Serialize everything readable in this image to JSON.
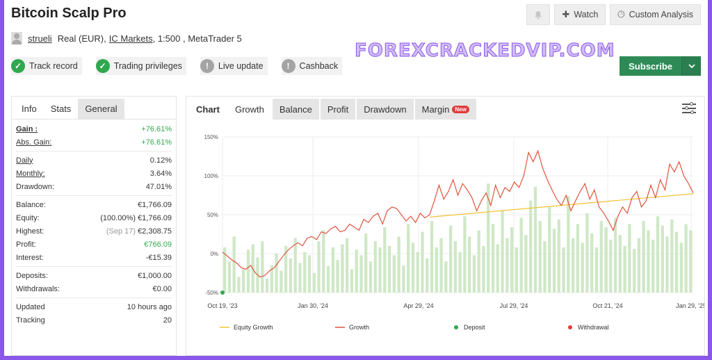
{
  "header": {
    "title": "Bitcoin Scalp Pro",
    "owner": "strueli",
    "account_type": "Real (EUR),",
    "broker": "IC Markets",
    "details": ", 1:500 , MetaTrader 5",
    "watch_label": "Watch",
    "custom_analysis_label": "Custom Analysis",
    "subscribe_label": "Subscribe"
  },
  "watermark": "FOREXCRACKEDVIP.COM",
  "badges": [
    {
      "label": "Track record",
      "status": "ok",
      "icon": "check-icon"
    },
    {
      "label": "Trading privileges",
      "status": "ok",
      "icon": "check-icon"
    },
    {
      "label": "Live update",
      "status": "warn",
      "icon": "exclamation-icon"
    },
    {
      "label": "Cashback",
      "status": "warn",
      "icon": "exclamation-icon"
    }
  ],
  "stats_tabs": [
    "Info",
    "Stats",
    "General"
  ],
  "stats": {
    "gain_label": "Gain :",
    "gain_value": "+76.61%",
    "abs_gain_label": "Abs. Gain:",
    "abs_gain_value": "+76.61%",
    "daily_label": "Daily",
    "daily_value": "0.12%",
    "monthly_label": "Monthly:",
    "monthly_value": "3.64%",
    "drawdown_label": "Drawdown:",
    "drawdown_value": "47.01%",
    "balance_label": "Balance:",
    "balance_value": "€1,766.09",
    "equity_label": "Equity:",
    "equity_pct": "(100.00%)",
    "equity_value": "€1,766.09",
    "highest_label": "Highest:",
    "highest_date": "(Sep 17)",
    "highest_value": "€2,308.75",
    "profit_label": "Profit:",
    "profit_value": "€766.09",
    "interest_label": "Interest:",
    "interest_value": "-€15.39",
    "deposits_label": "Deposits:",
    "deposits_value": "€1,000.00",
    "withdrawals_label": "Withdrawals:",
    "withdrawals_value": "€0.00",
    "updated_label": "Updated",
    "updated_value": "10 hours ago",
    "tracking_label": "Tracking",
    "tracking_value": "20"
  },
  "chart_tabs": [
    "Chart",
    "Growth",
    "Balance",
    "Profit",
    "Drawdown",
    "Margin"
  ],
  "new_badge": "New",
  "colors": {
    "growth": "#e0533d",
    "equity_growth": "#f2c231",
    "deposit": "#2fa84f",
    "withdrawal": "#e23b3b",
    "bars": "#cfe8c7",
    "subscribe": "#2e8b57"
  },
  "chart_data": {
    "type": "line",
    "ylim": [
      -50,
      150
    ],
    "yticks": [
      "150%",
      "100%",
      "50%",
      "0%",
      "-50%"
    ],
    "xticks": [
      "Oct 19, '23",
      "Jan 30, '24",
      "Apr 29, '24",
      "Jul 29, '24",
      "Oct 21, '24",
      "Jan 29, '25"
    ],
    "grid": true,
    "legend_position": "bottom",
    "series": [
      {
        "name": "Equity Growth",
        "type": "line",
        "x": [
          0,
          0.44,
          1.0
        ],
        "values": [
          null,
          47,
          77
        ]
      },
      {
        "name": "Growth",
        "type": "line",
        "x": [
          0,
          0.01,
          0.02,
          0.03,
          0.04,
          0.05,
          0.06,
          0.07,
          0.08,
          0.09,
          0.1,
          0.11,
          0.12,
          0.13,
          0.14,
          0.15,
          0.16,
          0.17,
          0.18,
          0.19,
          0.2,
          0.21,
          0.22,
          0.23,
          0.24,
          0.25,
          0.26,
          0.27,
          0.28,
          0.29,
          0.3,
          0.31,
          0.32,
          0.33,
          0.34,
          0.35,
          0.36,
          0.37,
          0.38,
          0.39,
          0.4,
          0.41,
          0.42,
          0.43,
          0.44,
          0.45,
          0.46,
          0.47,
          0.48,
          0.49,
          0.5,
          0.51,
          0.52,
          0.53,
          0.54,
          0.55,
          0.56,
          0.57,
          0.58,
          0.59,
          0.6,
          0.61,
          0.62,
          0.63,
          0.64,
          0.65,
          0.66,
          0.67,
          0.68,
          0.69,
          0.7,
          0.71,
          0.72,
          0.73,
          0.74,
          0.75,
          0.76,
          0.77,
          0.78,
          0.79,
          0.8,
          0.81,
          0.82,
          0.83,
          0.84,
          0.85,
          0.86,
          0.87,
          0.88,
          0.89,
          0.9,
          0.91,
          0.92,
          0.93,
          0.94,
          0.95,
          0.96,
          0.97,
          0.98,
          0.99,
          1.0
        ],
        "values": [
          2,
          -3,
          -8,
          -12,
          -18,
          -20,
          -15,
          -25,
          -30,
          -28,
          -22,
          -18,
          -10,
          -2,
          5,
          10,
          14,
          10,
          20,
          22,
          18,
          28,
          26,
          32,
          35,
          28,
          30,
          38,
          34,
          30,
          44,
          40,
          48,
          52,
          38,
          55,
          60,
          58,
          50,
          42,
          48,
          40,
          52,
          46,
          50,
          68,
          88,
          70,
          80,
          95,
          75,
          90,
          82,
          72,
          55,
          68,
          78,
          62,
          88,
          72,
          85,
          80,
          92,
          85,
          100,
          130,
          118,
          132,
          110,
          95,
          82,
          70,
          62,
          75,
          55,
          68,
          80,
          90,
          70,
          82,
          60,
          52,
          42,
          30,
          48,
          60,
          52,
          72,
          80,
          60,
          68,
          88,
          72,
          95,
          82,
          115,
          105,
          118,
          100,
          90,
          78
        ]
      },
      {
        "name": "Deposit",
        "type": "scatter",
        "x": [
          0
        ],
        "values": [
          -50
        ],
        "amount": "€1,000.00"
      },
      {
        "name": "Withdrawal",
        "type": "scatter",
        "x": [],
        "values": []
      }
    ],
    "bars": [
      58,
      40,
      72,
      20,
      30,
      55,
      62,
      45,
      66,
      18,
      35,
      50,
      28,
      60,
      44,
      70,
      38,
      52,
      48,
      25,
      66,
      80,
      34,
      58,
      42,
      62,
      70,
      30,
      55,
      48,
      76,
      40,
      66,
      58,
      84,
      60,
      48,
      72,
      35,
      88,
      64,
      52,
      78,
      44,
      92,
      58,
      70,
      40,
      86,
      66,
      52,
      98,
      72,
      48,
      80,
      60,
      140,
      88,
      62,
      106,
      70,
      84,
      58,
      96,
      74,
      118,
      136,
      92,
      66,
      110,
      82,
      94,
      58,
      124,
      70,
      88,
      64,
      102,
      76,
      58,
      92,
      84,
      68,
      96,
      74,
      60,
      88,
      56,
      70,
      92,
      80,
      68,
      98,
      86,
      72,
      94,
      78,
      64,
      88,
      80
    ]
  }
}
